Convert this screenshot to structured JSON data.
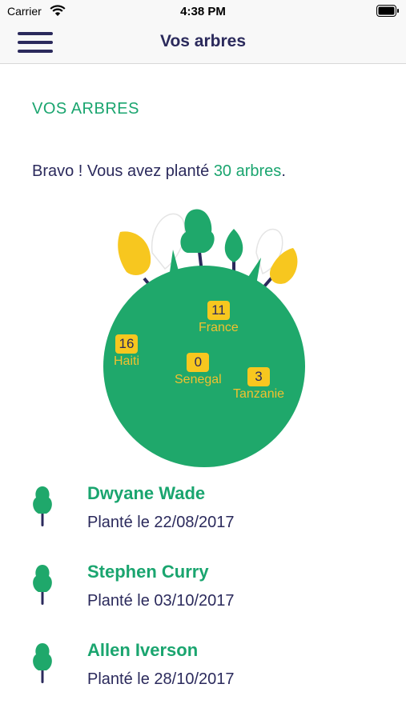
{
  "status_bar": {
    "carrier": "Carrier",
    "time": "4:38 PM",
    "icons": [
      "wifi-icon",
      "battery-icon"
    ]
  },
  "nav": {
    "title": "Vos arbres",
    "menu_icon": "hamburger-menu-icon"
  },
  "section": {
    "heading": "VOS ARBRES"
  },
  "summary": {
    "prefix": "Bravo ! Vous avez planté ",
    "count": "30 arbres",
    "suffix": "."
  },
  "globe": {
    "pins": [
      {
        "country": "France",
        "count": "11"
      },
      {
        "country": "Haiti",
        "count": "16"
      },
      {
        "country": "Senegal",
        "count": "0"
      },
      {
        "country": "Tanzanie",
        "count": "3"
      }
    ]
  },
  "trees": [
    {
      "name": "Dwyane Wade",
      "date": "Planté le 22/08/2017"
    },
    {
      "name": "Stephen Curry",
      "date": "Planté le 03/10/2017"
    },
    {
      "name": "Allen Iverson",
      "date": "Planté le 28/10/2017"
    }
  ],
  "colors": {
    "primary": "#2b2a5c",
    "accent_green": "#1aa56f",
    "globe_green": "#1fa86b",
    "yellow": "#f7c71f",
    "nav_background": "#f8f8f8"
  }
}
